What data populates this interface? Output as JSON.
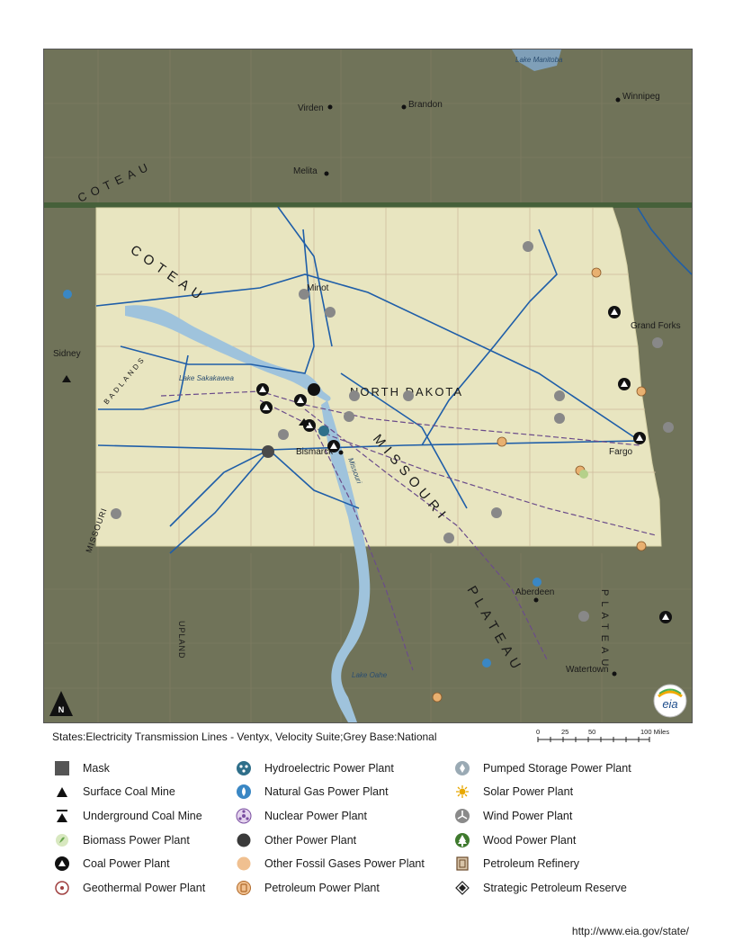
{
  "map": {
    "state_label": "NORTH DAKOTA",
    "colors": {
      "state_fill": "#e9e6c2",
      "mask_fill": "#6f725a",
      "water": "#9cc2dd",
      "transmission": "#1f5ea8",
      "pipeline": "#6b4c8a",
      "border": "#3f6b3a"
    },
    "places": [
      {
        "name": "Winnipeg"
      },
      {
        "name": "Brandon"
      },
      {
        "name": "Virden"
      },
      {
        "name": "Melita"
      },
      {
        "name": "Minot"
      },
      {
        "name": "Grand Forks"
      },
      {
        "name": "Sidney"
      },
      {
        "name": "Bismarck"
      },
      {
        "name": "Fargo"
      },
      {
        "name": "Aberdeen"
      },
      {
        "name": "Watertown"
      }
    ],
    "water_labels": {
      "lake_manitoba": "Lake Manitoba",
      "lake_sakakawea": "Lake Sakakawea",
      "missouri": "Missouri",
      "lake_oahe": "Lake Oahe"
    },
    "region_labels": {
      "coteau": "COTEAU",
      "badlands": "BADLANDS",
      "missouri_big": "MISSOURI",
      "plateau": "PLATEAU",
      "plateau2": "PLATEAU",
      "missouri_side": "MISSOURI",
      "side_text": "UPLAND"
    }
  },
  "caption": "States:Electricity Transmission Lines - Ventyx, Velocity Suite;Grey Base:National",
  "scale": {
    "ticks": [
      "0",
      "25",
      "50",
      "100 Miles"
    ]
  },
  "legend": {
    "col1": [
      {
        "label": "Mask",
        "icon": "mask-square-icon"
      },
      {
        "label": "Surface Coal Mine",
        "icon": "surface-coal-mine-icon"
      },
      {
        "label": "Underground Coal Mine",
        "icon": "underground-coal-mine-icon"
      },
      {
        "label": "Biomass Power Plant",
        "icon": "biomass-plant-icon"
      },
      {
        "label": "Coal Power Plant",
        "icon": "coal-plant-icon"
      },
      {
        "label": "Geothermal  Power Plant",
        "icon": "geothermal-plant-icon"
      }
    ],
    "col2": [
      {
        "label": "Hydroelectric Power Plant",
        "icon": "hydroelectric-plant-icon"
      },
      {
        "label": "Natural Gas Power Plant",
        "icon": "natural-gas-plant-icon"
      },
      {
        "label": "Nuclear Power Plant",
        "icon": "nuclear-plant-icon"
      },
      {
        "label": "Other Power Plant",
        "icon": "other-plant-icon"
      },
      {
        "label": "Other Fossil Gases Power Plant",
        "icon": "other-fossil-gases-plant-icon"
      },
      {
        "label": "Petroleum Power Plant",
        "icon": "petroleum-plant-icon"
      }
    ],
    "col3": [
      {
        "label": "Pumped Storage Power Plant",
        "icon": "pumped-storage-plant-icon"
      },
      {
        "label": "Solar Power Plant",
        "icon": "solar-plant-icon"
      },
      {
        "label": "Wind Power Plant",
        "icon": "wind-plant-icon"
      },
      {
        "label": "Wood Power Plant",
        "icon": "wood-plant-icon"
      },
      {
        "label": "Petroleum Refinery",
        "icon": "petroleum-refinery-icon"
      },
      {
        "label": "Strategic Petroleum Reserve",
        "icon": "strategic-petroleum-reserve-icon"
      }
    ]
  },
  "north_label": "N",
  "logo_text": "eia",
  "url": "http://www.eia.gov/state/"
}
